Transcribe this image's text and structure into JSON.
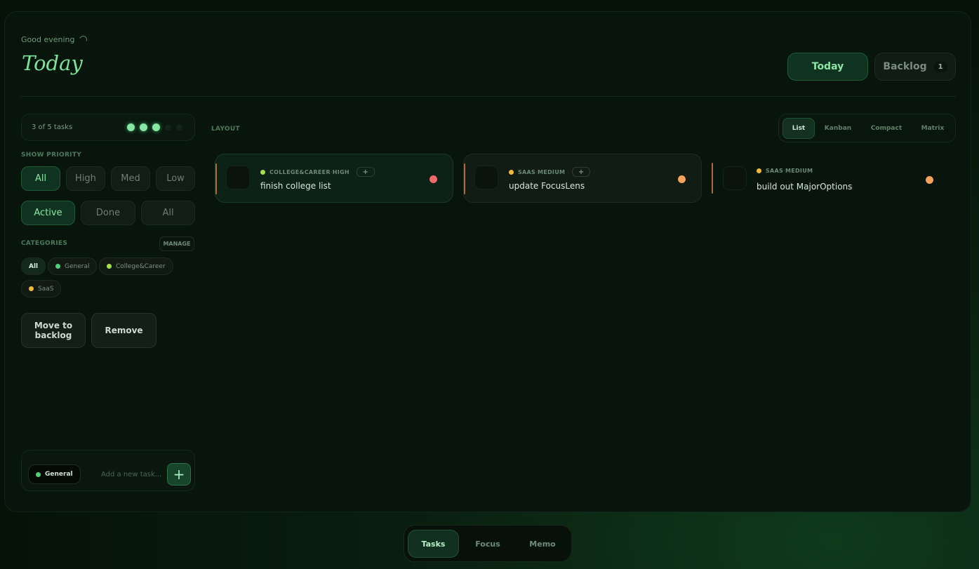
{
  "header": {
    "greeting": "Good evening",
    "title": "Today",
    "view_tabs": [
      {
        "label": "Today",
        "active": true
      },
      {
        "label": "Backlog",
        "count": "1",
        "active": false
      }
    ]
  },
  "sidebar": {
    "progress_text": "3 of 5 tasks",
    "progress": {
      "done": 3,
      "total": 5
    },
    "priority_label": "SHOW PRIORITY",
    "priority_filters": [
      "All",
      "High",
      "Med",
      "Low"
    ],
    "status_filters": [
      "Active",
      "Done",
      "All"
    ],
    "categories_label": "CATEGORIES",
    "manage_label": "MANAGE",
    "categories": [
      {
        "label": "All",
        "color": ""
      },
      {
        "label": "General",
        "color": "#4cd07a"
      },
      {
        "label": "College&Career",
        "color": "#a6e04a"
      },
      {
        "label": "SaaS",
        "color": "#f0b93a"
      }
    ],
    "move_to_backlog": "Move to backlog",
    "remove": "Remove",
    "add_task": {
      "category": "General",
      "placeholder": "Add a new task...",
      "add_icon": "+"
    }
  },
  "main": {
    "layout_label": "LAYOUT",
    "layout_tabs": [
      "List",
      "Kanban",
      "Compact",
      "Matrix"
    ],
    "tasks": [
      {
        "category": "COLLEGE&CAREER",
        "priority": "HIGH",
        "title": "finish college list",
        "category_color": "#a6e04a",
        "priority_color": "#f06a6a",
        "sep": "·",
        "plus": "+"
      },
      {
        "category": "SAAS",
        "priority": "MEDIUM",
        "title": "update FocusLens",
        "category_color": "#f0b93a",
        "priority_color": "#f5a35a",
        "sep": "·",
        "plus": "+"
      },
      {
        "category": "SAAS",
        "priority": "MEDIUM",
        "title": "build out MajorOptions",
        "category_color": "#f0b93a",
        "priority_color": "#f5a35a",
        "sep": "·"
      }
    ]
  },
  "bottom_nav": [
    "Tasks",
    "Focus",
    "Memo"
  ]
}
